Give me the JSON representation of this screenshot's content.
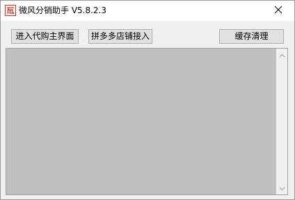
{
  "window": {
    "title": "微风分销助手  V5.8.2.3",
    "icon": "app-logo-icon",
    "close_icon": "close-icon"
  },
  "toolbar": {
    "enter_agent_label": "进入代购主界面",
    "pinduoduo_label": "拼多多店铺接入",
    "clear_cache_label": "缓存清理"
  },
  "log": {
    "value": ""
  },
  "colors": {
    "textarea_bg": "#c0c0c0",
    "button_bg": "#e1e1e1",
    "window_bg": "#f0f0f0",
    "titlebar_bg": "#ffffff"
  }
}
